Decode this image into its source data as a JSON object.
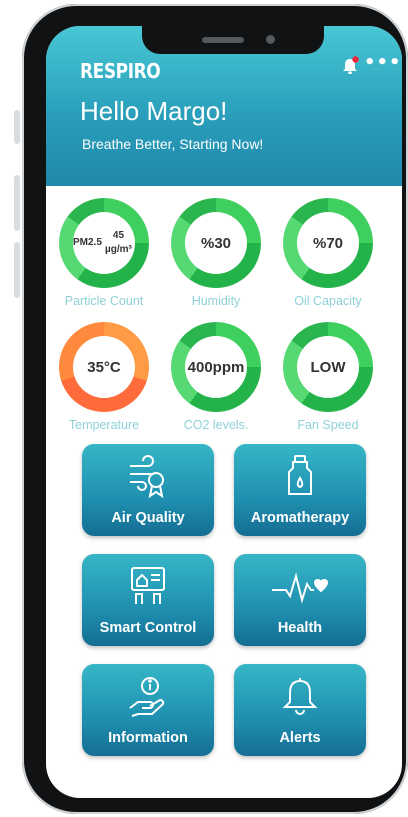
{
  "app": {
    "logo": "RESPIRO",
    "greeting": "Hello Margo!",
    "tagline": "Breathe Better, Starting Now!",
    "more": "•••"
  },
  "gauges": [
    {
      "line1": "PM2.5",
      "line2": "45 µg/m³",
      "label": "Particle Count",
      "status": "green"
    },
    {
      "line1": "%30",
      "label": "Humidity",
      "status": "green"
    },
    {
      "line1": "%70",
      "label": "Oil Capacity",
      "status": "green"
    },
    {
      "line1": "35°C",
      "label": "Temperature",
      "status": "red"
    },
    {
      "line1": "400",
      "line2": "ppm",
      "label": "CO2 levels.",
      "status": "green"
    },
    {
      "line1": "LOW",
      "label": "Fan Speed",
      "status": "green"
    }
  ],
  "tiles": [
    {
      "label": "Air Quality",
      "icon": "air-quality-icon"
    },
    {
      "label": "Aromatherapy",
      "icon": "oil-bottle-icon"
    },
    {
      "label": "Smart Control",
      "icon": "smart-control-icon"
    },
    {
      "label": "Health",
      "icon": "heartbeat-icon"
    },
    {
      "label": "Information",
      "icon": "information-icon"
    },
    {
      "label": "Alerts",
      "icon": "bell-icon"
    }
  ],
  "colors": {
    "header_top": "#48c7d4",
    "header_bottom": "#1f88ab",
    "gauge_green": "#2bb54f",
    "gauge_red": "#ff6b3a",
    "tile": "#1f8fb0",
    "label": "#8fd1d8"
  }
}
